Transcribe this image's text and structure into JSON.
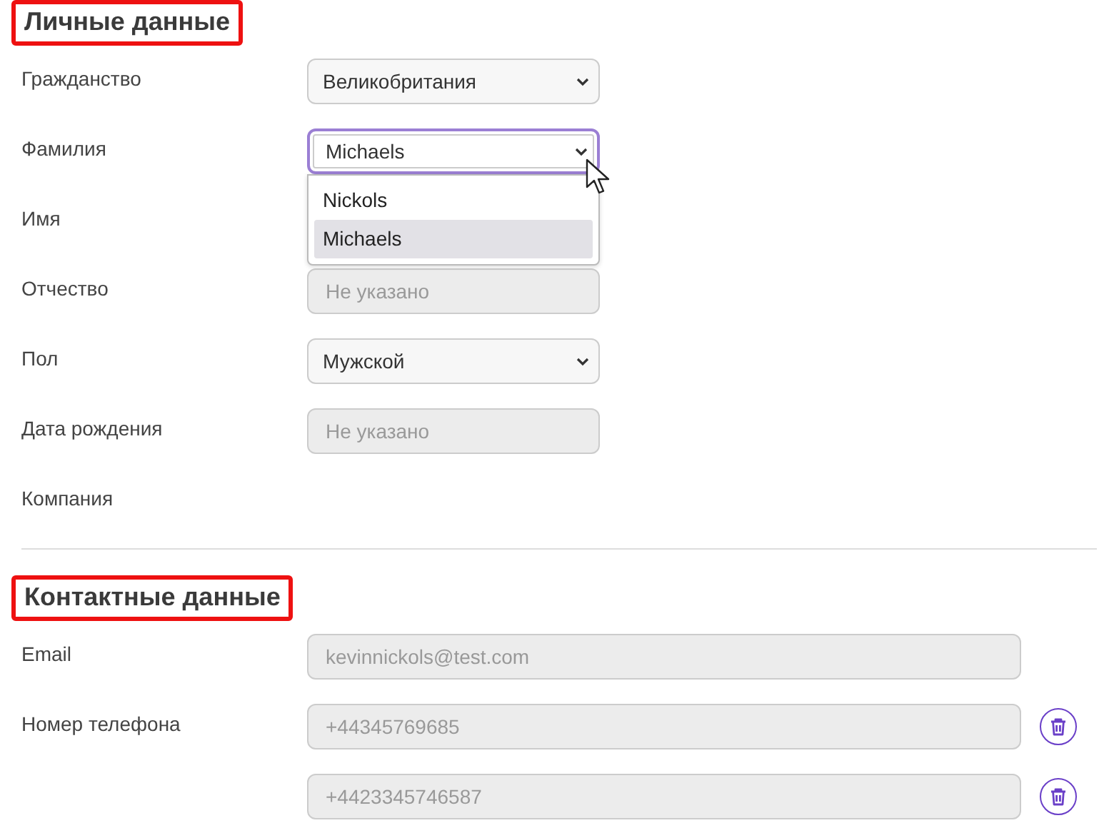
{
  "sections": [
    {
      "title": "Личные данные",
      "highlighted": true,
      "rows": [
        {
          "label": "Гражданство",
          "kind": "select",
          "value": "Великобритания",
          "focused": false
        },
        {
          "label": "Фамилия",
          "kind": "select",
          "value": "Michaels",
          "focused": true,
          "options": [
            {
              "label": "Nickols",
              "selected": false
            },
            {
              "label": "Michaels",
              "selected": true
            }
          ]
        },
        {
          "label": "Имя",
          "kind": "hidden"
        },
        {
          "label": "Отчество",
          "kind": "input",
          "placeholder": "Не указано",
          "disabled": true,
          "wide": false
        },
        {
          "label": "Пол",
          "kind": "select",
          "value": "Мужской",
          "focused": false
        },
        {
          "label": "Дата рождения",
          "kind": "input",
          "placeholder": "Не указано",
          "disabled": true,
          "wide": false
        },
        {
          "label": "Компания",
          "kind": "none"
        }
      ]
    },
    {
      "title": "Контактные данные",
      "highlighted": true,
      "rows": [
        {
          "label": "Email",
          "kind": "input",
          "value": "kevinnickols@test.com",
          "disabled": true,
          "wide": true
        },
        {
          "label": "Номер телефона",
          "kind": "input",
          "value": "+44345769685",
          "disabled": true,
          "wide": true,
          "deletable": true
        },
        {
          "kind": "input",
          "value": "+4423345746587",
          "disabled": true,
          "wide": true,
          "deletable": true
        }
      ]
    }
  ]
}
